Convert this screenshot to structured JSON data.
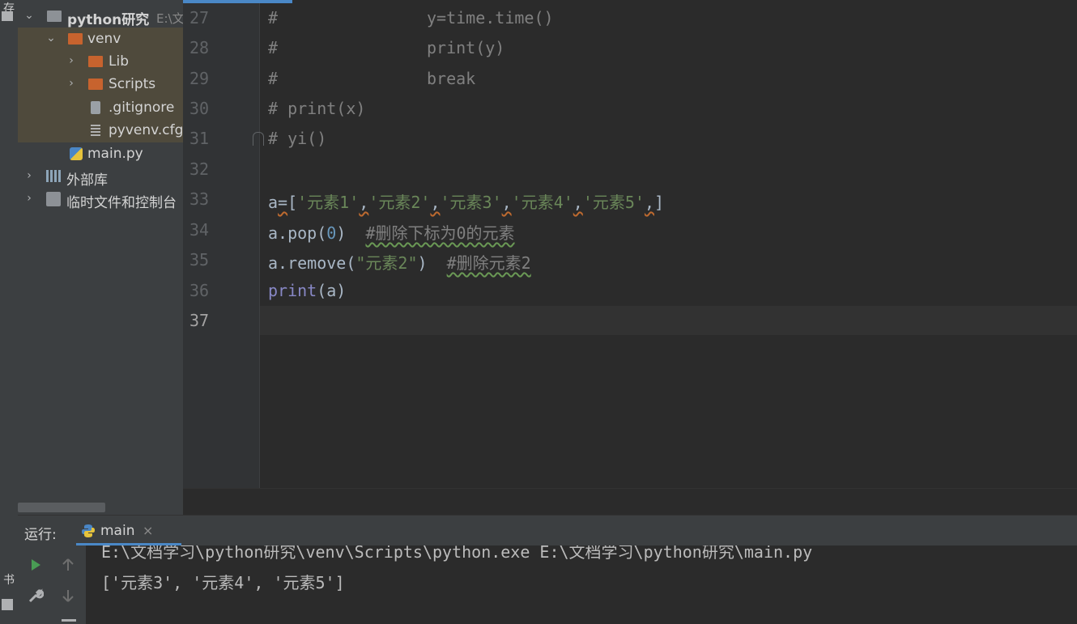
{
  "left_strip": {
    "top_label": "存",
    "bottom_label": "书"
  },
  "project_tree": [
    {
      "label": "python研究",
      "path_hint": "E:\\文",
      "level": 0,
      "arrow": "⌄",
      "icon": "folder-grey"
    },
    {
      "label": "venv",
      "level": 1,
      "arrow": "⌄",
      "icon": "folder-orange"
    },
    {
      "label": "Lib",
      "level": 2,
      "arrow": "›",
      "icon": "folder-orange"
    },
    {
      "label": "Scripts",
      "level": 2,
      "arrow": "›",
      "icon": "folder-orange"
    },
    {
      "label": ".gitignore",
      "level": 2,
      "arrow": "",
      "icon": "file-ignore"
    },
    {
      "label": "pyvenv.cfg",
      "level": 2,
      "arrow": "",
      "icon": "file-text"
    },
    {
      "label": "main.py",
      "level": 1,
      "arrow": "",
      "icon": "python-file"
    },
    {
      "label": "外部库",
      "level": 0,
      "arrow": "›",
      "icon": "library"
    },
    {
      "label": "临时文件和控制台",
      "level": 0,
      "arrow": "›",
      "icon": "scratch"
    }
  ],
  "editor": {
    "line_numbers": [
      "27",
      "28",
      "29",
      "30",
      "31",
      "32",
      "33",
      "34",
      "35",
      "36",
      "37"
    ],
    "lines": {
      "l27": {
        "a": "#",
        "b": "y=time.time()"
      },
      "l28": {
        "a": "#",
        "b": "print(y)"
      },
      "l29": {
        "a": "#",
        "b": "break"
      },
      "l30": "# print(x)",
      "l31": "# yi()",
      "l33": {
        "var": "a",
        "eq": "=",
        "lb": "[",
        "s1": "'元素1'",
        "s2": "'元素2'",
        "s3": "'元素3'",
        "s4": "'元素4'",
        "s5": "'元素5'",
        "comma": ",",
        "rb": "]"
      },
      "l34": {
        "call": "a.pop(",
        "arg": "0",
        "close": ")",
        "comment": "#删除下标为0的元素"
      },
      "l35": {
        "call": "a.remove(",
        "arg": "\"元素2\"",
        "close": ")",
        "comment": "#删除元素2"
      },
      "l36": {
        "fn": "print",
        "args": "(a)"
      }
    }
  },
  "run_panel": {
    "label": "运行:",
    "tab_name": "main",
    "close_glyph": "×",
    "console_lines": [
      "E:\\文档学习\\python研究\\venv\\Scripts\\python.exe E:\\文档学习\\python研究\\main.py",
      "['元素3', '元素4', '元素5']"
    ]
  },
  "colors": {
    "accent": "#4a88c7",
    "comment": "#808080",
    "string": "#6a8759",
    "number": "#6897bb",
    "builtin": "#8888c6"
  }
}
